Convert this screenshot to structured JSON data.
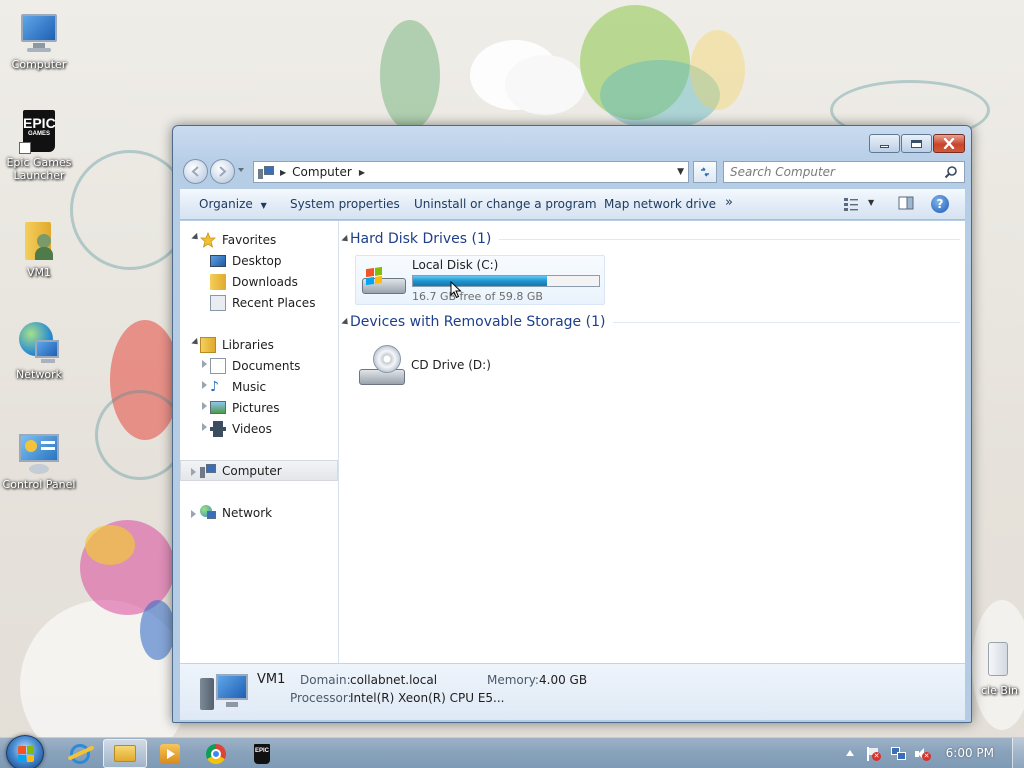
{
  "desktop": {
    "icons": [
      {
        "label": "Computer"
      },
      {
        "label": "Epic Games Launcher",
        "logo": "EPIC",
        "logo_sub": "GAMES"
      },
      {
        "label": "VM1"
      },
      {
        "label": "Network"
      },
      {
        "label": "Control Panel"
      },
      {
        "label": "cle Bin"
      }
    ]
  },
  "window": {
    "breadcrumb": [
      "Computer"
    ],
    "search_placeholder": "Search Computer",
    "toolbar": {
      "organize": "Organize",
      "system_properties": "System properties",
      "uninstall": "Uninstall or change a program",
      "map_drive": "Map network drive",
      "more": "»"
    },
    "nav": {
      "favorites": "Favorites",
      "favorites_items": [
        "Desktop",
        "Downloads",
        "Recent Places"
      ],
      "libraries": "Libraries",
      "libraries_items": [
        "Documents",
        "Music",
        "Pictures",
        "Videos"
      ],
      "computer": "Computer",
      "network": "Network"
    },
    "groups": {
      "hard_disk": "Hard Disk Drives (1)",
      "removable": "Devices with Removable Storage (1)"
    },
    "drives": {
      "local": {
        "name": "Local Disk (C:)",
        "usage": "16.7 GB free of 59.8 GB",
        "used_fraction": 0.72
      },
      "cd": {
        "name": "CD Drive (D:)"
      }
    },
    "details": {
      "name": "VM1",
      "domain_label": "Domain:",
      "domain": "collabnet.local",
      "memory_label": "Memory:",
      "memory": "4.00 GB",
      "processor_label": "Processor:",
      "processor": "Intel(R) Xeon(R) CPU E5..."
    }
  },
  "taskbar": {
    "epic_logo": "EPIC",
    "clock": "6:00 PM"
  },
  "colors": {
    "accent": "#1e3f8a",
    "progress": "#1f94cf",
    "taskbar": "#8aa3bc"
  }
}
